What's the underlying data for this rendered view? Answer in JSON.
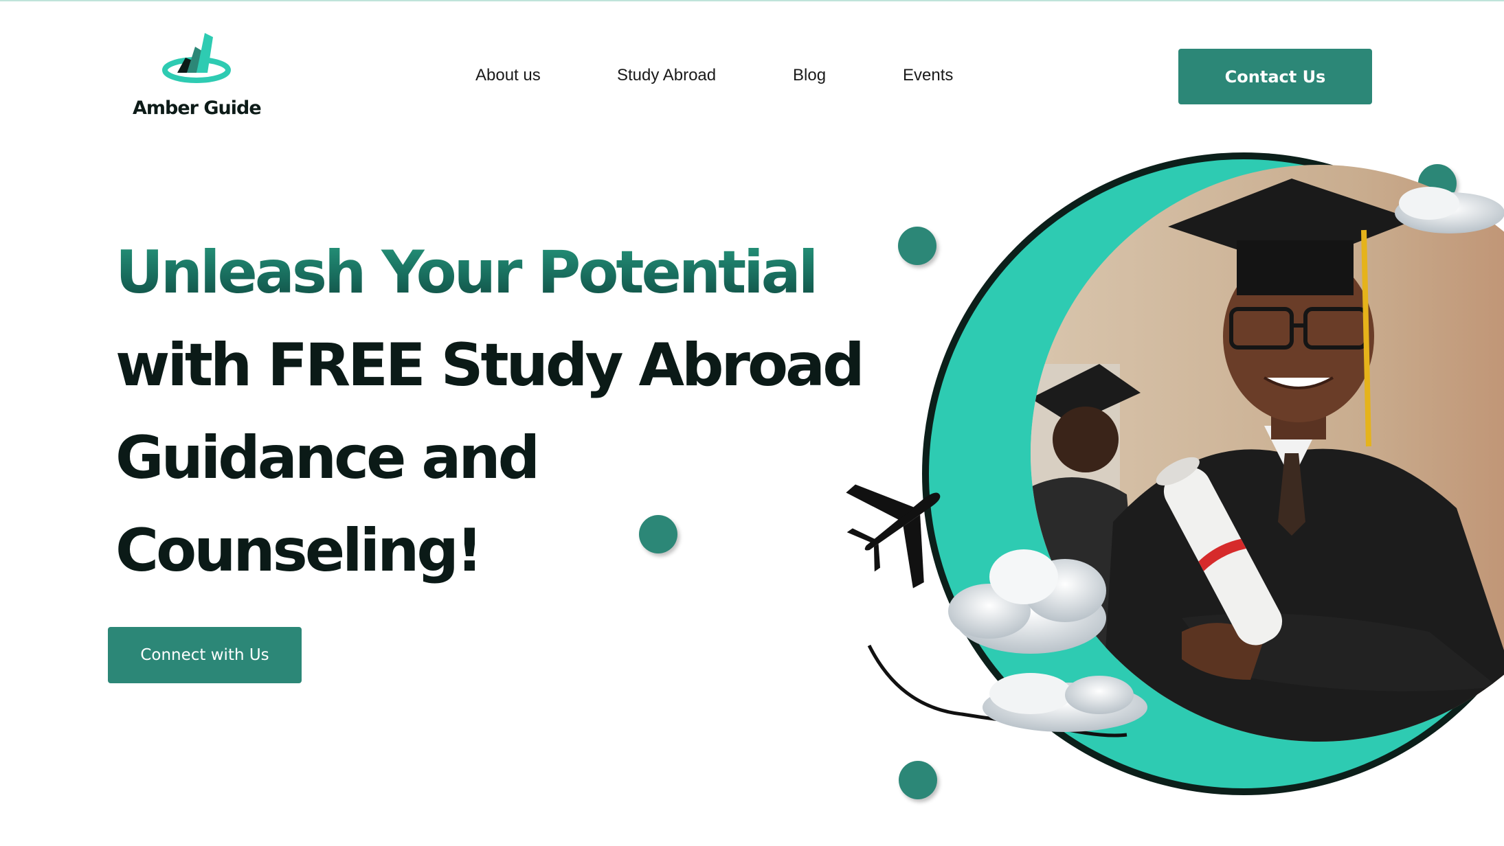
{
  "brand": {
    "name": "Amber Guide",
    "logo_icon": "bar-chart-logo-icon",
    "colors": {
      "primary": "#2c8777",
      "accent": "#2ecbb2",
      "dark": "#0b1a17"
    }
  },
  "nav": {
    "items": [
      {
        "label": "About us"
      },
      {
        "label": "Study Abroad"
      },
      {
        "label": "Blog"
      },
      {
        "label": "Events"
      }
    ],
    "contact_label": "Contact Us"
  },
  "hero": {
    "headline_lines": [
      "Unleash Your Potential",
      "with FREE Study Abroad",
      "Guidance and",
      "Counseling!"
    ],
    "cta_label": "Connect with Us",
    "image": "graduate-portrait",
    "decor_icons": [
      "airplane-icon",
      "cloud-icon"
    ]
  }
}
